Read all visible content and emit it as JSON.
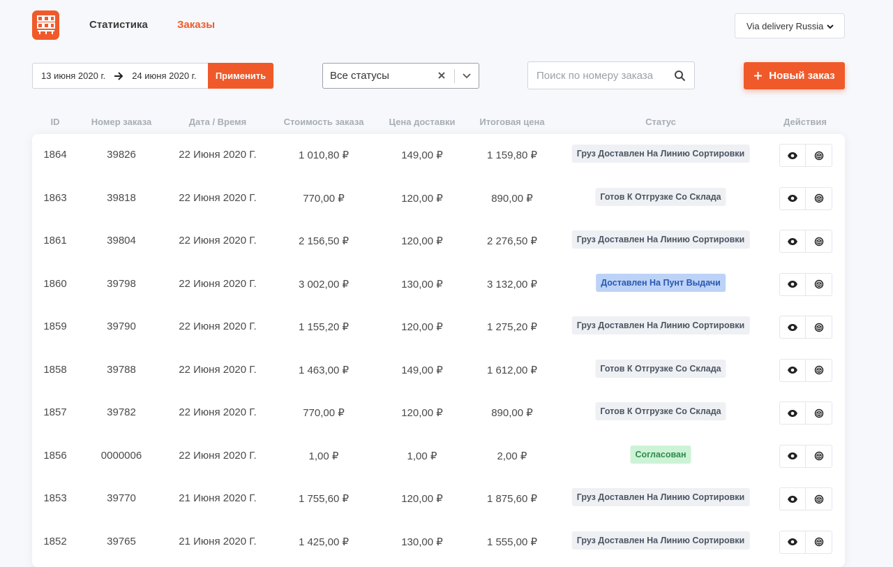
{
  "nav": {
    "stats": "Статистика",
    "orders": "Заказы",
    "company": "Via delivery Russia"
  },
  "filters": {
    "date_from": "13 июня 2020 г.",
    "date_to": "24 июня 2020 г.",
    "apply_label": "Применить",
    "status_value": "Все статусы",
    "search_placeholder": "Поиск по номеру заказа",
    "new_order_label": "Новый заказ"
  },
  "colors": {
    "accent": "#f05a2a"
  },
  "table": {
    "headers": [
      "ID",
      "Номер заказа",
      "Дата / Время",
      "Стоимость заказа",
      "Цена доставки",
      "Итоговая цена",
      "Статус",
      "Действия"
    ],
    "rows": [
      {
        "id": "1864",
        "number": "39826",
        "date": "22 Июня 2020 Г.",
        "cost": "1 010,80 ₽",
        "delivery": "149,00 ₽",
        "total": "1 159,80 ₽",
        "status": "Груз Доставлен На Линию Сортировки",
        "status_type": "gray"
      },
      {
        "id": "1863",
        "number": "39818",
        "date": "22 Июня 2020 Г.",
        "cost": "770,00 ₽",
        "delivery": "120,00 ₽",
        "total": "890,00 ₽",
        "status": "Готов К Отгрузке Со Склада",
        "status_type": "gray"
      },
      {
        "id": "1861",
        "number": "39804",
        "date": "22 Июня 2020 Г.",
        "cost": "2 156,50 ₽",
        "delivery": "120,00 ₽",
        "total": "2 276,50 ₽",
        "status": "Груз Доставлен На Линию Сортировки",
        "status_type": "gray"
      },
      {
        "id": "1860",
        "number": "39798",
        "date": "22 Июня 2020 Г.",
        "cost": "3 002,00 ₽",
        "delivery": "130,00 ₽",
        "total": "3 132,00 ₽",
        "status": "Доставлен На Пунт Выдачи",
        "status_type": "blue"
      },
      {
        "id": "1859",
        "number": "39790",
        "date": "22 Июня 2020 Г.",
        "cost": "1 155,20 ₽",
        "delivery": "120,00 ₽",
        "total": "1 275,20 ₽",
        "status": "Груз Доставлен На Линию Сортировки",
        "status_type": "gray"
      },
      {
        "id": "1858",
        "number": "39788",
        "date": "22 Июня 2020 Г.",
        "cost": "1 463,00 ₽",
        "delivery": "149,00 ₽",
        "total": "1 612,00 ₽",
        "status": "Готов К Отгрузке Со Склада",
        "status_type": "gray"
      },
      {
        "id": "1857",
        "number": "39782",
        "date": "22 Июня 2020 Г.",
        "cost": "770,00 ₽",
        "delivery": "120,00 ₽",
        "total": "890,00 ₽",
        "status": "Готов К Отгрузке Со Склада",
        "status_type": "gray"
      },
      {
        "id": "1856",
        "number": "0000006",
        "date": "22 Июня 2020 Г.",
        "cost": "1,00 ₽",
        "delivery": "1,00 ₽",
        "total": "2,00 ₽",
        "status": "Согласован",
        "status_type": "green"
      },
      {
        "id": "1853",
        "number": "39770",
        "date": "21 Июня 2020 Г.",
        "cost": "1 755,60 ₽",
        "delivery": "120,00 ₽",
        "total": "1 875,60 ₽",
        "status": "Груз Доставлен На Линию Сортировки",
        "status_type": "gray"
      },
      {
        "id": "1852",
        "number": "39765",
        "date": "21 Июня 2020 Г.",
        "cost": "1 425,00 ₽",
        "delivery": "130,00 ₽",
        "total": "1 555,00 ₽",
        "status": "Груз Доставлен На Линию Сортировки",
        "status_type": "gray"
      }
    ]
  }
}
